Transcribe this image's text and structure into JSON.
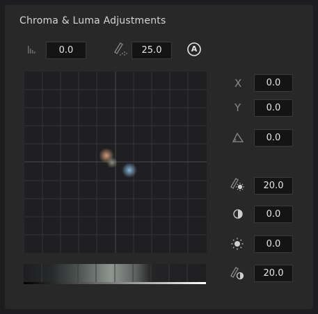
{
  "panel": {
    "title": "Chroma & Luma Adjustments"
  },
  "top_row": {
    "histogram_value": "0.0",
    "softness_value": "25.0",
    "auto_label": "A"
  },
  "side_controls": {
    "x_label": "X",
    "x_value": "0.0",
    "y_label": "Y",
    "y_value": "0.0",
    "angle_value": "0.0",
    "chroma_softness_value": "20.0",
    "contrast_value": "0.0",
    "brightness_value": "0.0",
    "luma_softness_value": "20.0"
  },
  "colors": {
    "panel_bg": "#282828",
    "field_bg": "#141414",
    "grid_line": "#3a3a3a",
    "border_top_left": "#e8712a",
    "border_top_right": "#b23fd6",
    "border_bottom_left": "#2fcf4c",
    "border_bottom_right": "#2f7fe0"
  },
  "icons": {
    "histogram": "histogram-icon",
    "softness": "pen-softness-icon",
    "auto": "auto-a-icon",
    "angle": "angle-icon",
    "chroma_softness": "pen-sun-icon",
    "contrast": "contrast-icon",
    "brightness": "sun-icon",
    "luma_softness": "pen-drop-icon"
  }
}
